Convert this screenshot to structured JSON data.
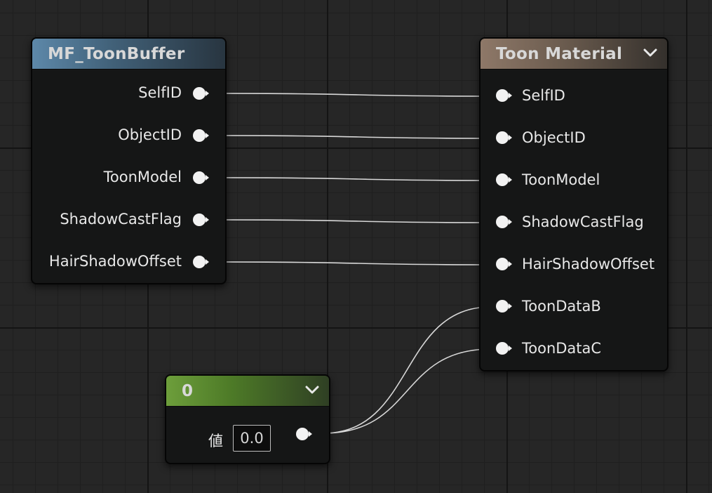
{
  "nodes": {
    "toon_buffer": {
      "title": "MF_ToonBuffer",
      "outputs": [
        "SelfID",
        "ObjectID",
        "ToonModel",
        "ShadowCastFlag",
        "HairShadowOffset"
      ]
    },
    "toon_material": {
      "title": "Toon Material",
      "inputs": [
        "SelfID",
        "ObjectID",
        "ToonModel",
        "ShadowCastFlag",
        "HairShadowOffset",
        "ToonDataB",
        "ToonDataC"
      ]
    },
    "constant": {
      "title": "0",
      "value_label": "値",
      "value": "0.0"
    }
  },
  "icons": {
    "pin": "pin-icon",
    "collapse": "chevron-down-icon"
  },
  "colors": {
    "canvas": "#262626",
    "node_body": "#151616",
    "toon_buffer_header": "#5d88a9",
    "toon_material_header": "#8e7868",
    "constant_header": "#6d9e3b",
    "wire": "#d8d8d8"
  }
}
